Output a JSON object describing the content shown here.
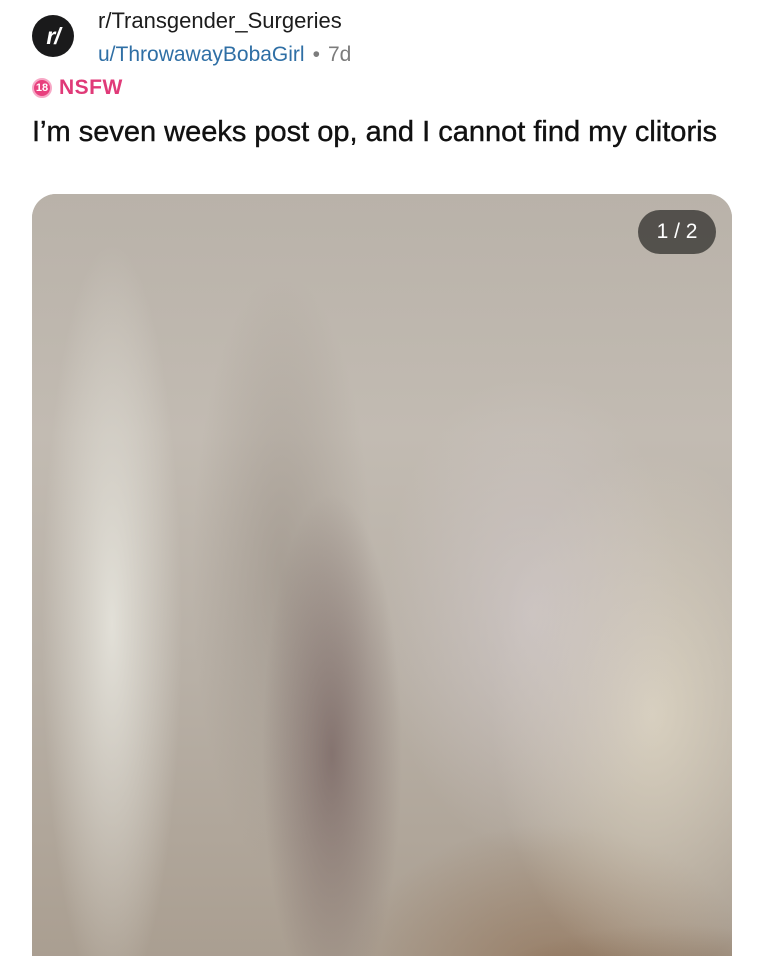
{
  "post": {
    "subreddit_icon": "r/",
    "subreddit": "r/Transgender_Surgeries",
    "username": "u/ThrowawayBobaGirl",
    "separator": "•",
    "age": "7d",
    "nsfw": {
      "badge": "18",
      "label": "NSFW",
      "color": "#e03a78"
    },
    "title": "I’m seven weeks post op, and I cannot find my clitoris",
    "media": {
      "counter": "1 / 2",
      "blurred": true
    }
  },
  "colors": {
    "username": "#2f6fa5",
    "text": "#111111",
    "muted": "#7c7c7c"
  }
}
